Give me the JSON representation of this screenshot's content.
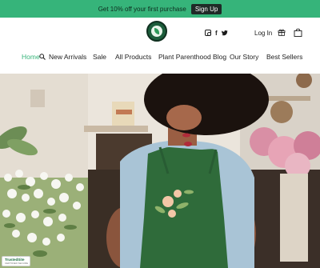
{
  "announcement": {
    "text": "Get 10% off your first purchase",
    "button_label": "Sign Up"
  },
  "header": {
    "login_label": "Log In",
    "social": [
      "instagram",
      "facebook",
      "twitter"
    ],
    "icons": [
      "gift-icon",
      "cart-icon",
      "search-icon"
    ]
  },
  "nav": {
    "items": [
      {
        "label": "Home",
        "active": true
      },
      {
        "label": "New Arrivals"
      },
      {
        "label": "Sale"
      },
      {
        "label": "All Products"
      },
      {
        "label": "Plant Parenthood Blog"
      },
      {
        "label": "Our Story"
      },
      {
        "label": "Best Sellers"
      }
    ]
  },
  "badge": {
    "title": "TrustedSite",
    "subtitle": "CERTIFIED SECURE"
  },
  "colors": {
    "accent": "#36b47a",
    "dark": "#1f2a27"
  }
}
